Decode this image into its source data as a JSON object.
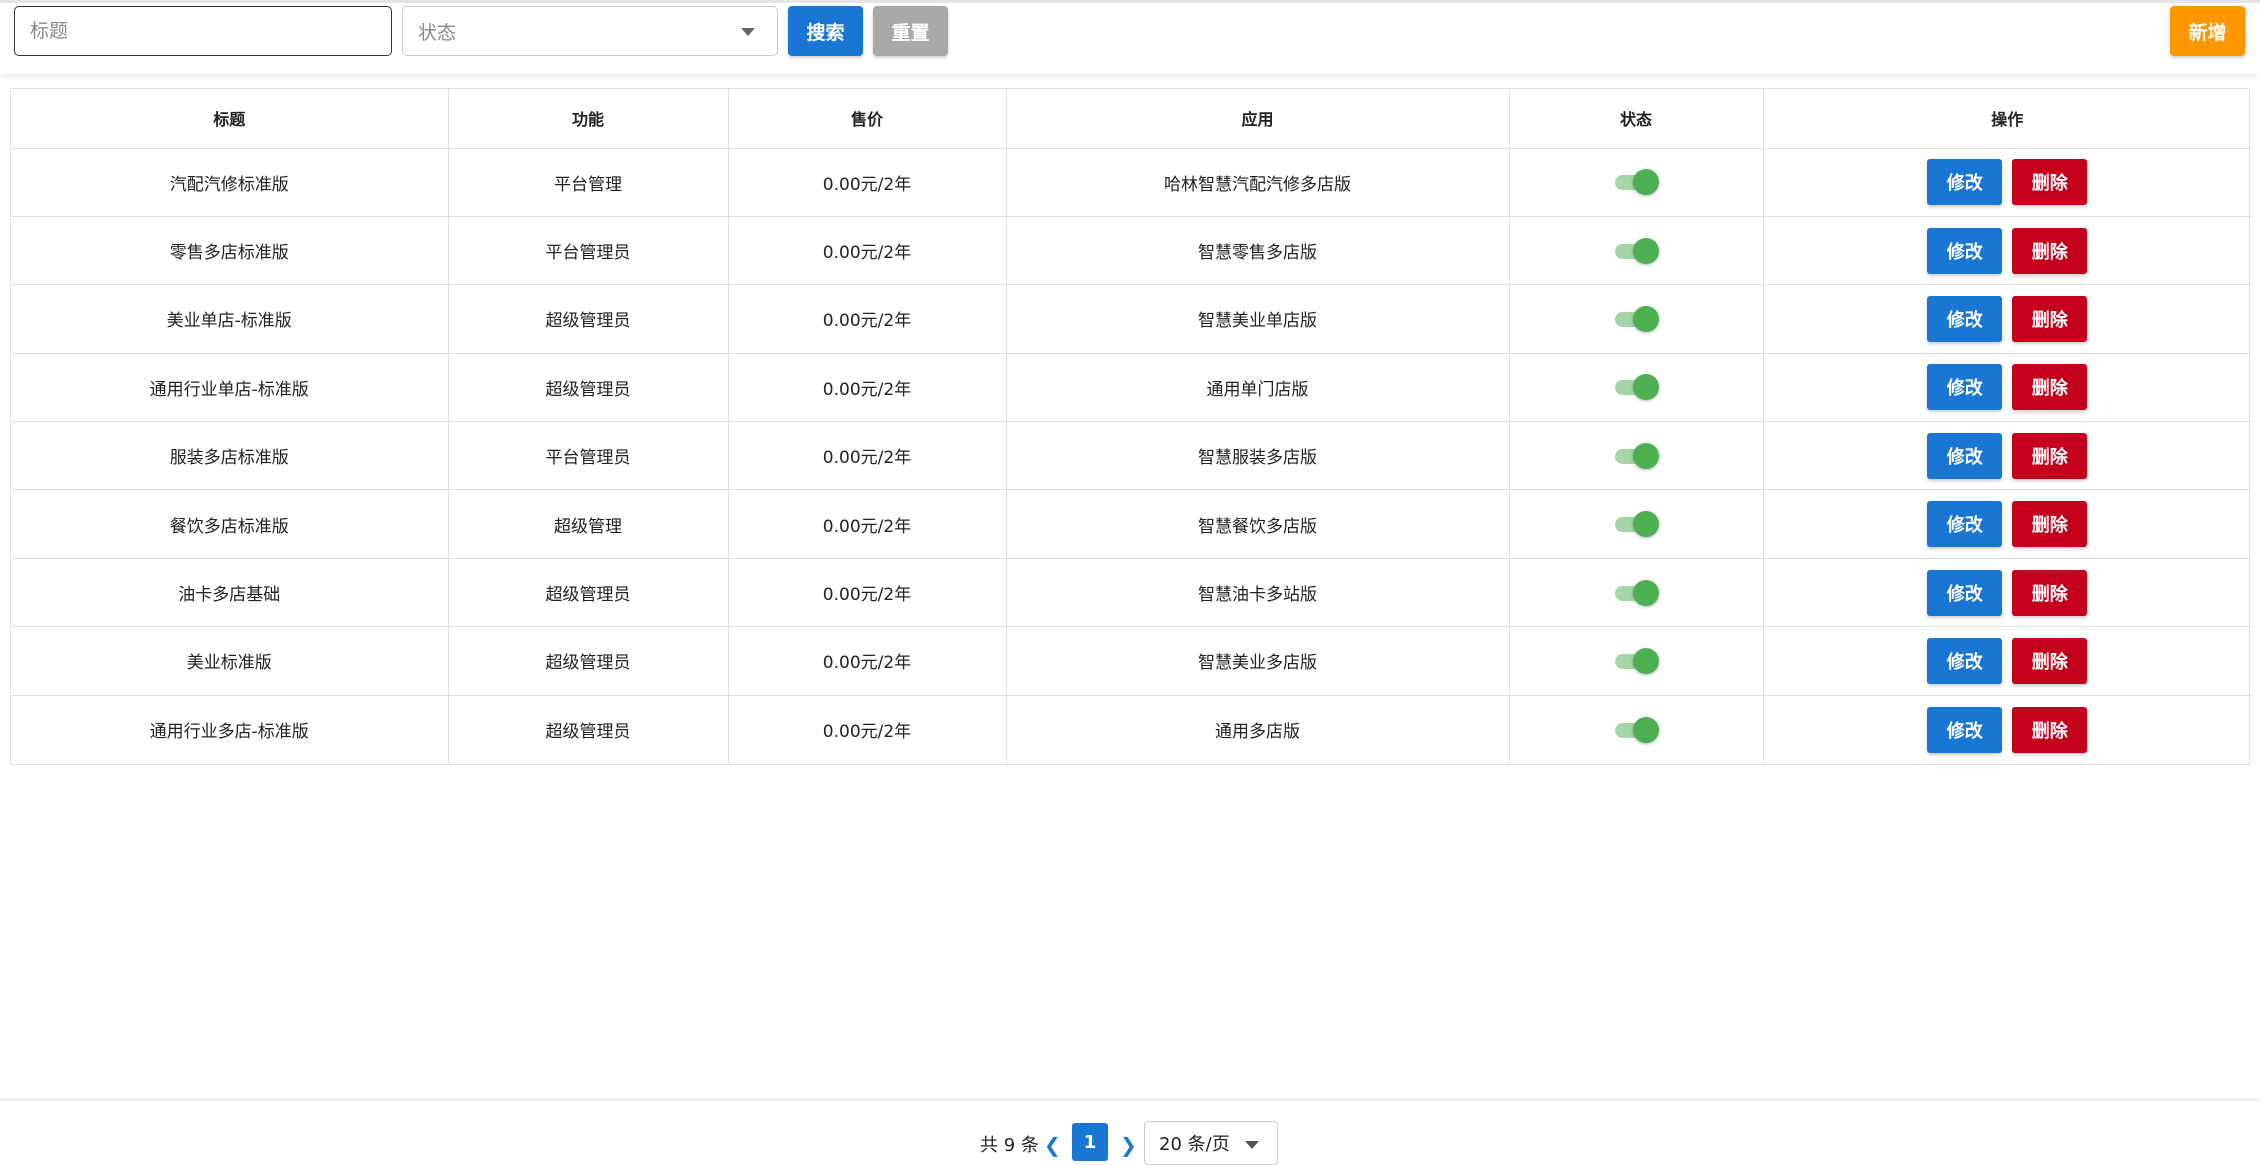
{
  "filters": {
    "title_placeholder": "标题",
    "status_placeholder": "状态",
    "search_label": "搜索",
    "reset_label": "重置",
    "add_label": "新增"
  },
  "table": {
    "headers": [
      "标题",
      "功能",
      "售价",
      "应用",
      "状态",
      "操作"
    ],
    "rows": [
      {
        "title": "汽配汽修标准版",
        "function": "平台管理",
        "price": "0.00元/2年",
        "app": "哈林智慧汽配汽修多店版",
        "enabled": true
      },
      {
        "title": "零售多店标准版",
        "function": "平台管理员",
        "price": "0.00元/2年",
        "app": "智慧零售多店版",
        "enabled": true
      },
      {
        "title": "美业单店-标准版",
        "function": "超级管理员",
        "price": "0.00元/2年",
        "app": "智慧美业单店版",
        "enabled": true
      },
      {
        "title": "通用行业单店-标准版",
        "function": "超级管理员",
        "price": "0.00元/2年",
        "app": "通用单门店版",
        "enabled": true
      },
      {
        "title": "服装多店标准版",
        "function": "平台管理员",
        "price": "0.00元/2年",
        "app": "智慧服装多店版",
        "enabled": true
      },
      {
        "title": "餐饮多店标准版",
        "function": "超级管理",
        "price": "0.00元/2年",
        "app": "智慧餐饮多店版",
        "enabled": true
      },
      {
        "title": "油卡多店基础",
        "function": "超级管理员",
        "price": "0.00元/2年",
        "app": "智慧油卡多站版",
        "enabled": true
      },
      {
        "title": "美业标准版",
        "function": "超级管理员",
        "price": "0.00元/2年",
        "app": "智慧美业多店版",
        "enabled": true
      },
      {
        "title": "通用行业多店-标准版",
        "function": "超级管理员",
        "price": "0.00元/2年",
        "app": "通用多店版",
        "enabled": true
      }
    ],
    "edit_label": "修改",
    "delete_label": "删除"
  },
  "pagination": {
    "total_text": "共 9 条",
    "current_page": "1",
    "page_size": "20 条/页"
  },
  "colors": {
    "primary": "#1976d2",
    "danger": "#c4001d",
    "warning": "#ff9800",
    "neutral": "#a9a9a9",
    "switch_on": "#4caf50"
  }
}
